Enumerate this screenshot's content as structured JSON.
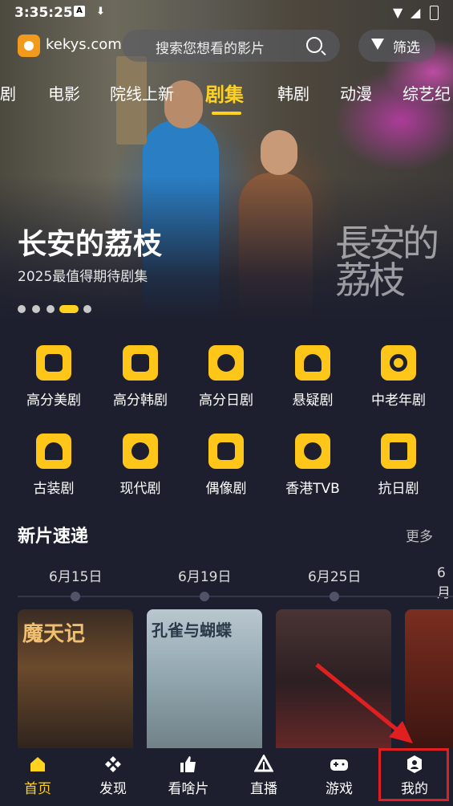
{
  "status_bar": {
    "time": "3:35:25",
    "icons": [
      "a-notification-icon",
      "download-icon"
    ],
    "right_icons": [
      "wifi-icon",
      "signal-icon",
      "battery-icon"
    ]
  },
  "header": {
    "site": "kekys.com",
    "search_placeholder": "搜索您想看的影片",
    "filter_label": "筛选"
  },
  "tabs": [
    {
      "label": "剧"
    },
    {
      "label": "电影"
    },
    {
      "label": "院线上新"
    },
    {
      "label": "剧集",
      "active": true
    },
    {
      "label": "韩剧"
    },
    {
      "label": "动漫"
    },
    {
      "label": "综艺纪"
    }
  ],
  "hero": {
    "title": "长安的荔枝",
    "subtitle": "2025最值得期待剧集",
    "watermark": "長安的荔枝",
    "slides": 5,
    "active_slide": 4
  },
  "categories": [
    {
      "label": "高分美剧",
      "icon": "film-reel-icon"
    },
    {
      "label": "高分韩剧",
      "icon": "chart-up-icon"
    },
    {
      "label": "高分日剧",
      "icon": "slash-circle-icon"
    },
    {
      "label": "悬疑剧",
      "icon": "mystery-icon"
    },
    {
      "label": "中老年剧",
      "icon": "ring-icon"
    },
    {
      "label": "古装剧",
      "icon": "bell-icon"
    },
    {
      "label": "现代剧",
      "icon": "dots-icon"
    },
    {
      "label": "偶像剧",
      "icon": "pulse-icon"
    },
    {
      "label": "香港TVB",
      "icon": "stripes-icon"
    },
    {
      "label": "抗日剧",
      "icon": "flag-icon"
    }
  ],
  "section": {
    "title": "新片速递",
    "more": "更多"
  },
  "timeline": [
    {
      "date": "6月15日"
    },
    {
      "date": "6月19日"
    },
    {
      "date": "6月25日"
    },
    {
      "date": "6月"
    }
  ],
  "posters": [
    {
      "title": "魔天记"
    },
    {
      "title": "孔雀与蝴蝶"
    },
    {
      "title": ""
    },
    {
      "title": ""
    }
  ],
  "bottom_nav": [
    {
      "label": "首页",
      "icon": "home-icon",
      "active": true
    },
    {
      "label": "发现",
      "icon": "discover-icon"
    },
    {
      "label": "看啥片",
      "icon": "thumbs-up-icon"
    },
    {
      "label": "直播",
      "icon": "live-icon"
    },
    {
      "label": "游戏",
      "icon": "gamepad-icon"
    },
    {
      "label": "我的",
      "icon": "profile-icon",
      "highlighted": true
    }
  ],
  "colors": {
    "accent": "#ffd21f",
    "background": "#1d1f2e",
    "highlight": "#e02020"
  }
}
